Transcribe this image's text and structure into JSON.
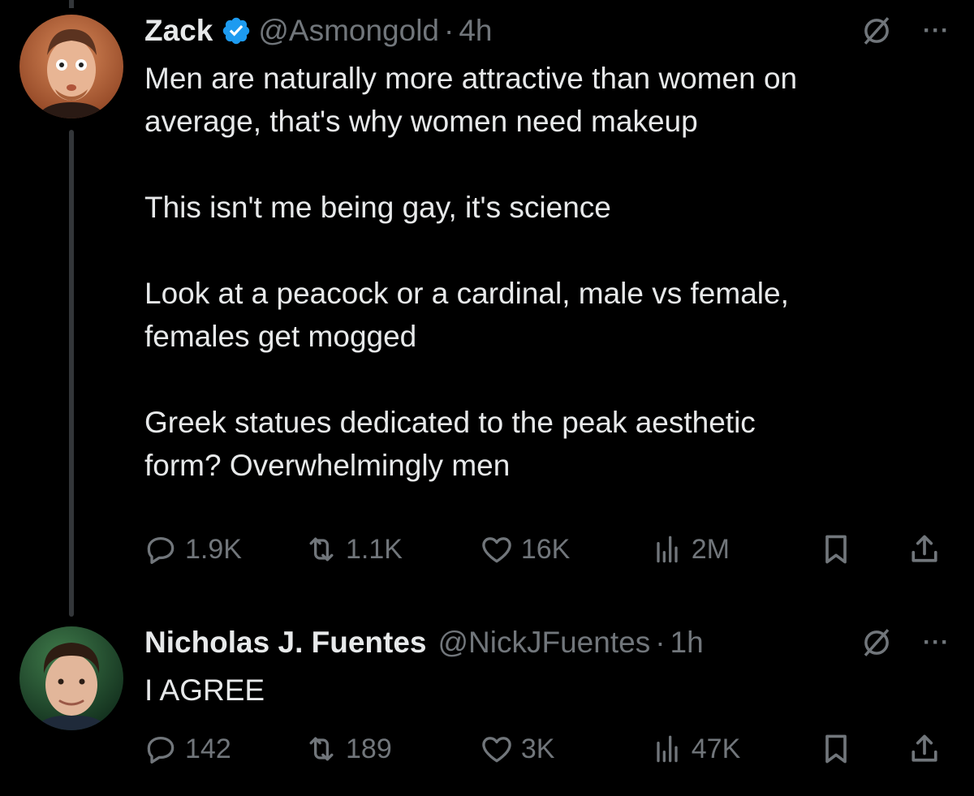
{
  "tweets": [
    {
      "author_name": "Zack",
      "handle": "@Asmongold",
      "dot": "·",
      "time": "4h",
      "verified": true,
      "text": "Men are naturally more attractive than women on\naverage, that's why women need makeup\n\nThis isn't me being gay, it's science\n\nLook at a peacock or a cardinal, male vs female,\nfemales get mogged\n\nGreek statues dedicated to the peak aesthetic\nform? Overwhelmingly men",
      "replies": "1.9K",
      "reposts": "1.1K",
      "likes": "16K",
      "views": "2M",
      "more": "···"
    },
    {
      "author_name": "Nicholas J. Fuentes",
      "handle": "@NickJFuentes",
      "dot": "·",
      "time": "1h",
      "verified": false,
      "text": "I AGREE",
      "replies": "142",
      "reposts": "189",
      "likes": "3K",
      "views": "47K",
      "more": "···"
    }
  ],
  "colors": {
    "background": "#000000",
    "text": "#e7e9ea",
    "secondary": "#71767b",
    "verified": "#1d9bf0",
    "thread_line": "#333639"
  },
  "icons": [
    "reply-icon",
    "repost-icon",
    "like-icon",
    "views-icon",
    "bookmark-icon",
    "share-icon",
    "grok-icon",
    "more-icon",
    "verified-badge-icon"
  ]
}
